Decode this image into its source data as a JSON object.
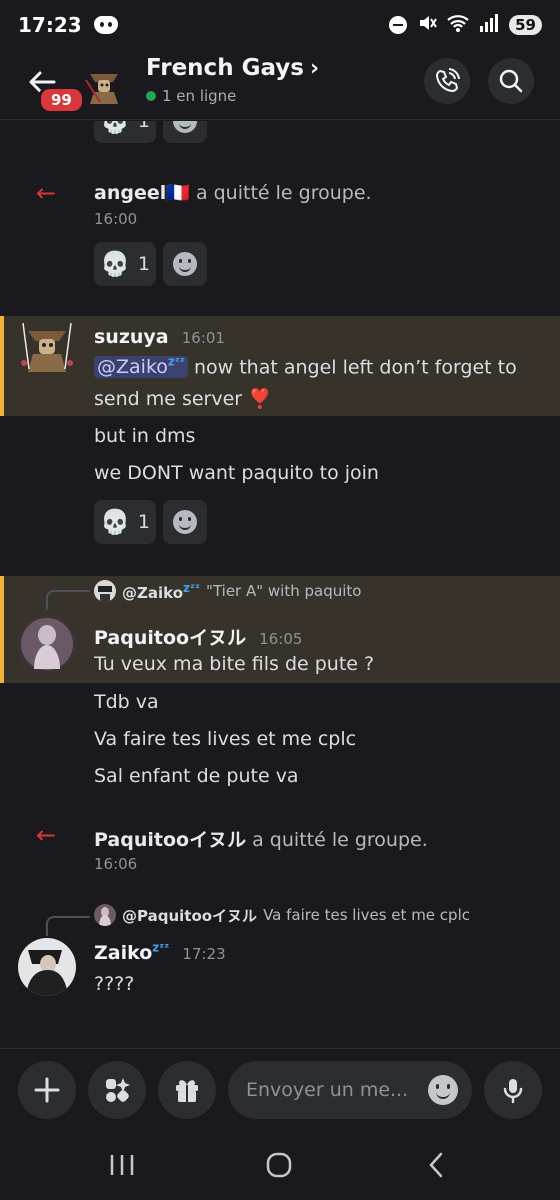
{
  "status_bar": {
    "time": "17:23",
    "battery": "59"
  },
  "header": {
    "unread_count": "99",
    "channel_name": "French Gays",
    "online_status": "1 en ligne"
  },
  "messages": {
    "top_reactions": {
      "skull_count": "1"
    },
    "system1": {
      "user": "angeel🇫🇷",
      "text": "a quitté le groupe.",
      "time": "16:00",
      "skull_count": "1"
    },
    "suzuya": {
      "author": "suzuya",
      "time": "16:01",
      "mention": "@Zaiko",
      "line1_rest": "now that angel left don’t forget to",
      "line2": "send me server",
      "line2_emoji": "❣️",
      "line3": "but in dms",
      "line4": "we DONT want paquito to join",
      "skull_count": "1"
    },
    "paquito": {
      "reply_name": "@Zaiko",
      "reply_text": "\"Tier A\" with paquito",
      "author": "Paquitooイヌル",
      "time": "16:05",
      "line1": "Tu veux ma bite fils de pute ?",
      "line2": "Tdb va",
      "line3": "Va faire tes lives et me cplc",
      "line4": "Sal enfant de pute va"
    },
    "system2": {
      "user": "Paquitooイヌル",
      "text": "a quitté le groupe.",
      "time": "16:06"
    },
    "zaiko": {
      "reply_name": "@Paquitooイヌル",
      "reply_text": "Va faire tes lives et me cplc",
      "author": "Zaiko",
      "time": "17:23",
      "line1": "????"
    },
    "zzz": "zᶻᶻ"
  },
  "composer": {
    "placeholder": "Envoyer un me..."
  },
  "colors": {
    "accent_red": "#da373c",
    "online_green": "#23a55a",
    "highlight_bar": "#f0b232",
    "mention_bg": "#3c4270"
  }
}
